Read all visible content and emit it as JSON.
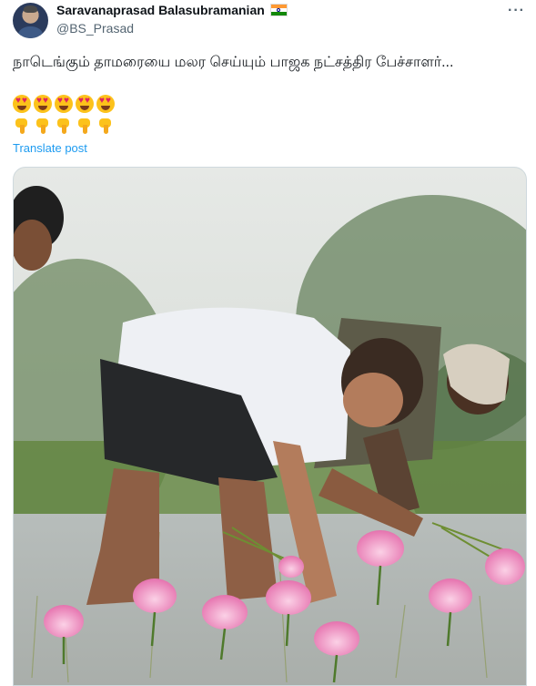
{
  "post": {
    "author_name": "Saravanaprasad Balasubramanian",
    "handle": "@BS_Prasad",
    "text": "நாடெங்கும் தாமரையை மலர செய்யும் பாஜக நட்சத்திர பேச்சாளர்...",
    "emoji_rows": [
      [
        "smiling-face-with-heart-eyes",
        "smiling-face-with-heart-eyes",
        "smiling-face-with-heart-eyes",
        "smiling-face-with-heart-eyes",
        "smiling-face-with-heart-eyes"
      ],
      [
        "backhand-index-pointing-down",
        "backhand-index-pointing-down",
        "backhand-index-pointing-down",
        "backhand-index-pointing-down",
        "backhand-index-pointing-down"
      ]
    ],
    "translate_label": "Translate post",
    "more_label": "···"
  },
  "icons": {
    "flag": "india-flag-icon",
    "more": "more-options-icon"
  },
  "colors": {
    "link": "#1d9bf0",
    "secondary_text": "#536471",
    "primary_text": "#0f1419"
  }
}
